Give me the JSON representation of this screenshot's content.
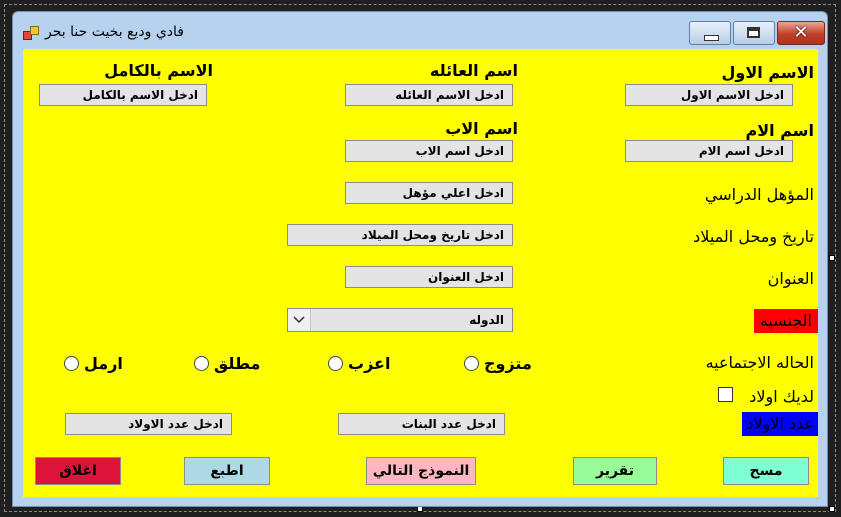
{
  "window": {
    "title": "فادي وديع بخيت حنا بحر"
  },
  "labels": {
    "first_name": "الاسم الاول",
    "family_name": "اسم العائله",
    "full_name": "الاسم بالكامل",
    "mother_name": "اسم الام",
    "father_name": "اسم الاب",
    "qualification": "المؤهل الدراسي",
    "birth": "تاريخ ومحل الميلاد",
    "address": "العنوان",
    "nationality": "الجنسيه",
    "marital_status": "الحاله الاجتماعيه",
    "has_children": "لديك اولاد",
    "children_count": "عدد الاولاد"
  },
  "inputs": {
    "first_name": "ادخل الاسم الاول",
    "family_name": "ادخل الاسم العائله",
    "full_name": "ادخل الاسم بالكامل",
    "mother_name": "ادخل اسم الام",
    "father_name": "ادخل اسم الاب",
    "qualification": "ادخل اعلي مؤهل",
    "birth": "ادخل تاريخ ومحل الميلاد",
    "address": "ادخل العنوان",
    "daughters": "ادخل عدد البنات",
    "sons": "ادخل عدد الاولاد"
  },
  "nationality_combo": {
    "value": "الدوله"
  },
  "marital_options": [
    "متزوج",
    "اعزب",
    "مطلق",
    "ارمل"
  ],
  "buttons": {
    "clear": "مسح",
    "report": "تقرير",
    "next_form": "النموذج التالي",
    "print": "اطبع",
    "close": "اغلاق"
  },
  "colors": {
    "form_background": "#ffff00",
    "nationality_label_bg": "#ff0000",
    "children_count_label_bg": "#0000ff"
  }
}
